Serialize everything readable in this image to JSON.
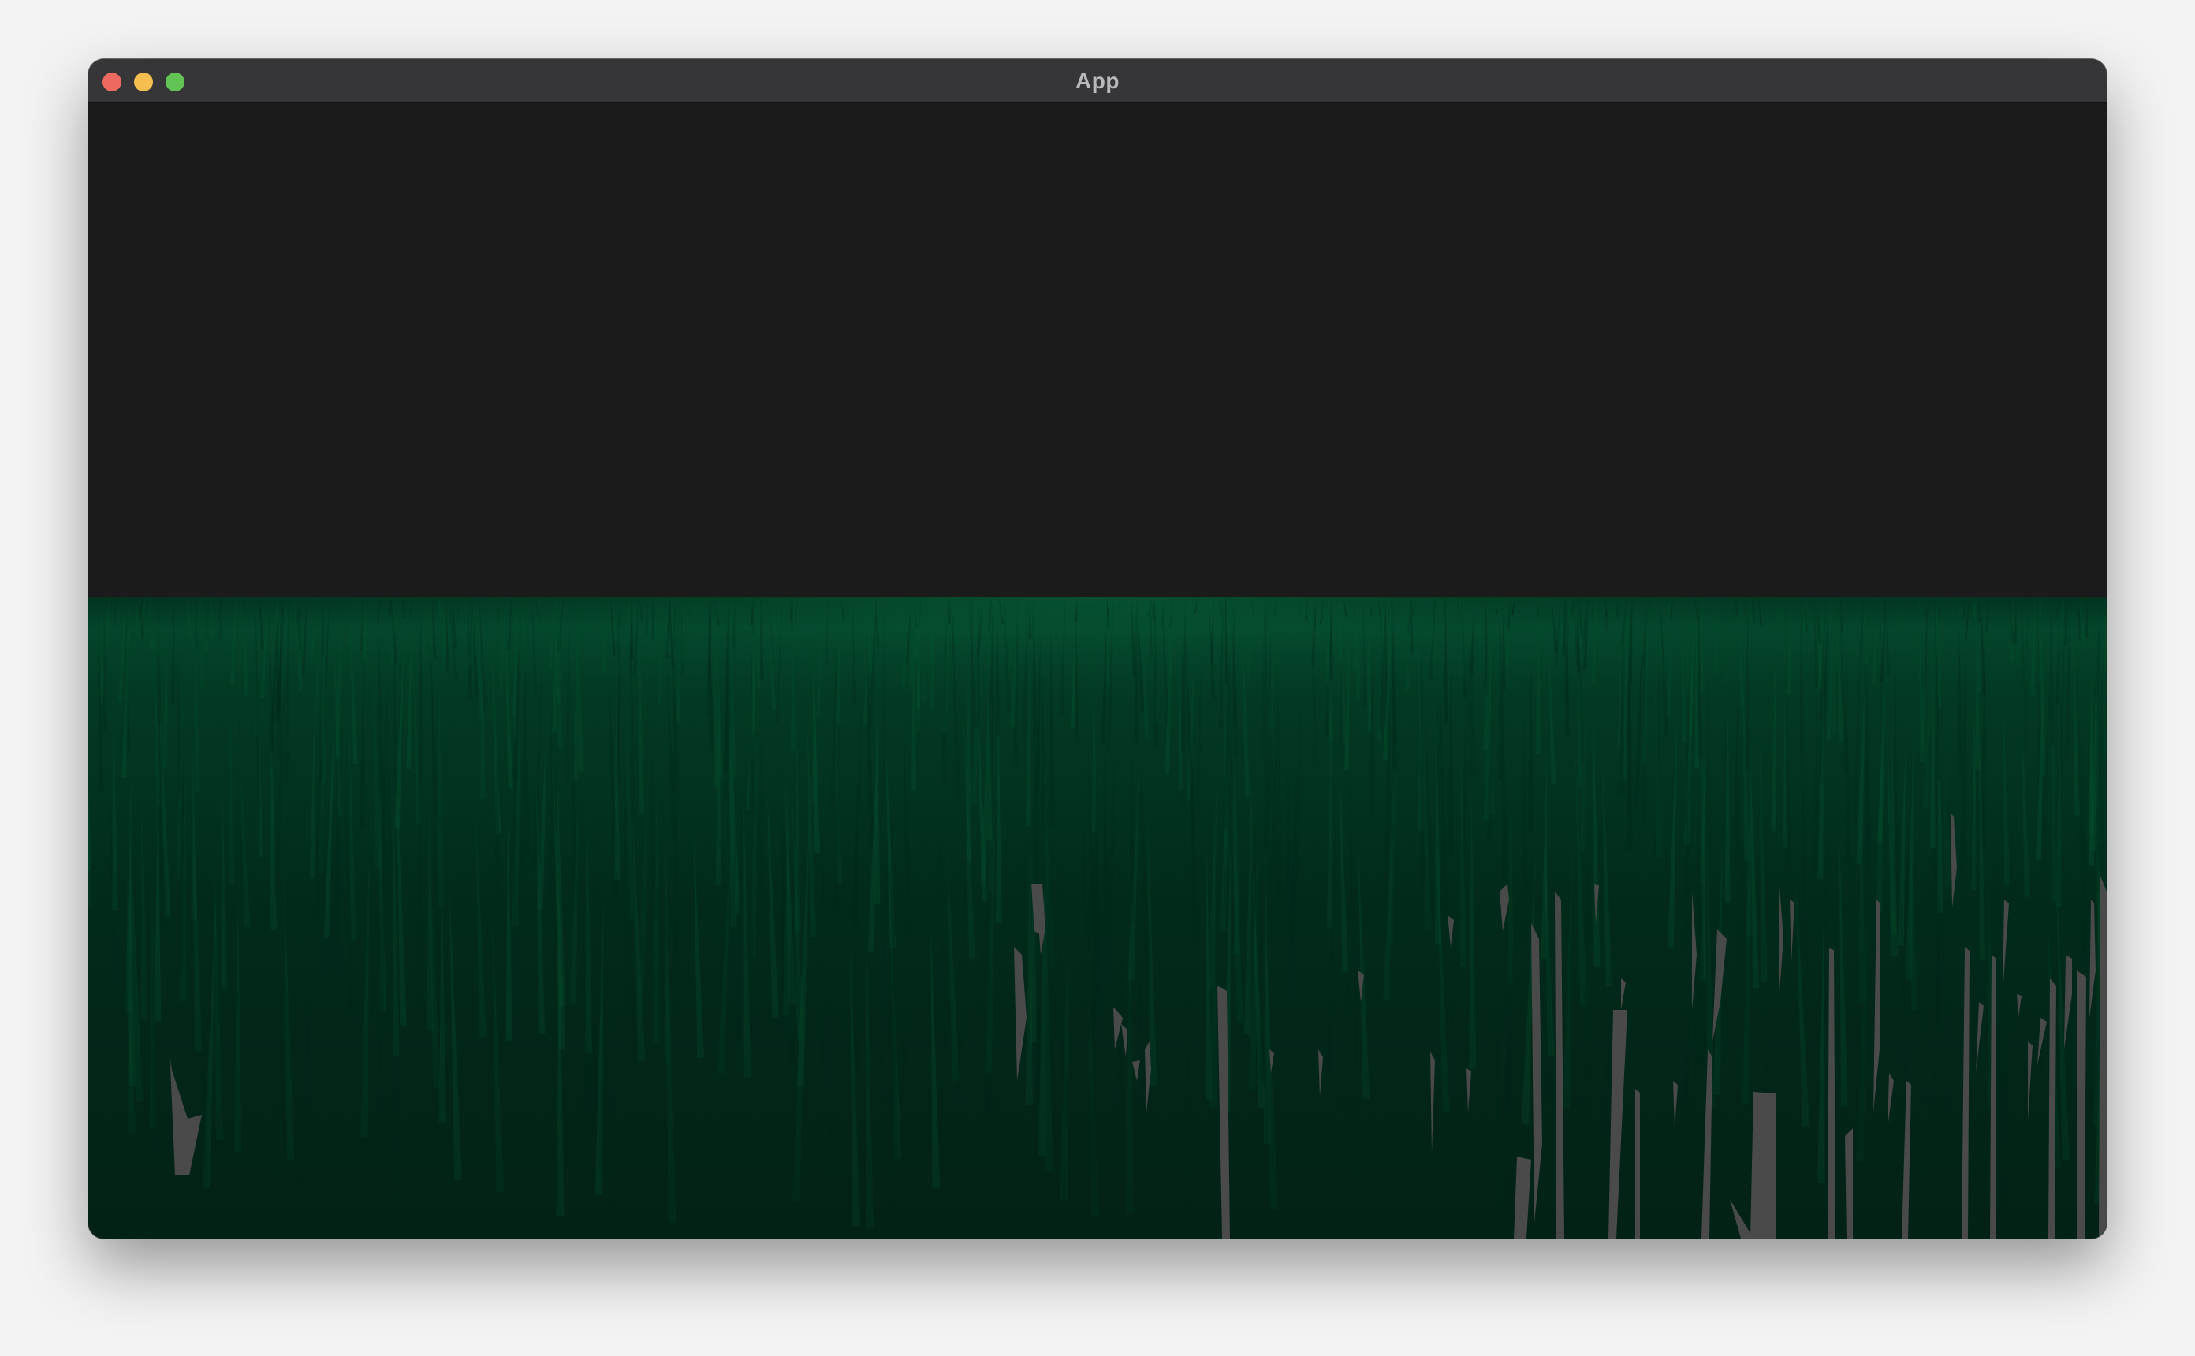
{
  "window": {
    "title": "App"
  },
  "colors": {
    "sky": "#1b1b1b",
    "grass_horizon": "#04452a",
    "grass_mid": "#033521",
    "grass_near": "#022619",
    "gap": "#474747"
  },
  "icons": {
    "close": "close-button",
    "minimize": "minimize-button",
    "zoom": "zoom-button"
  }
}
